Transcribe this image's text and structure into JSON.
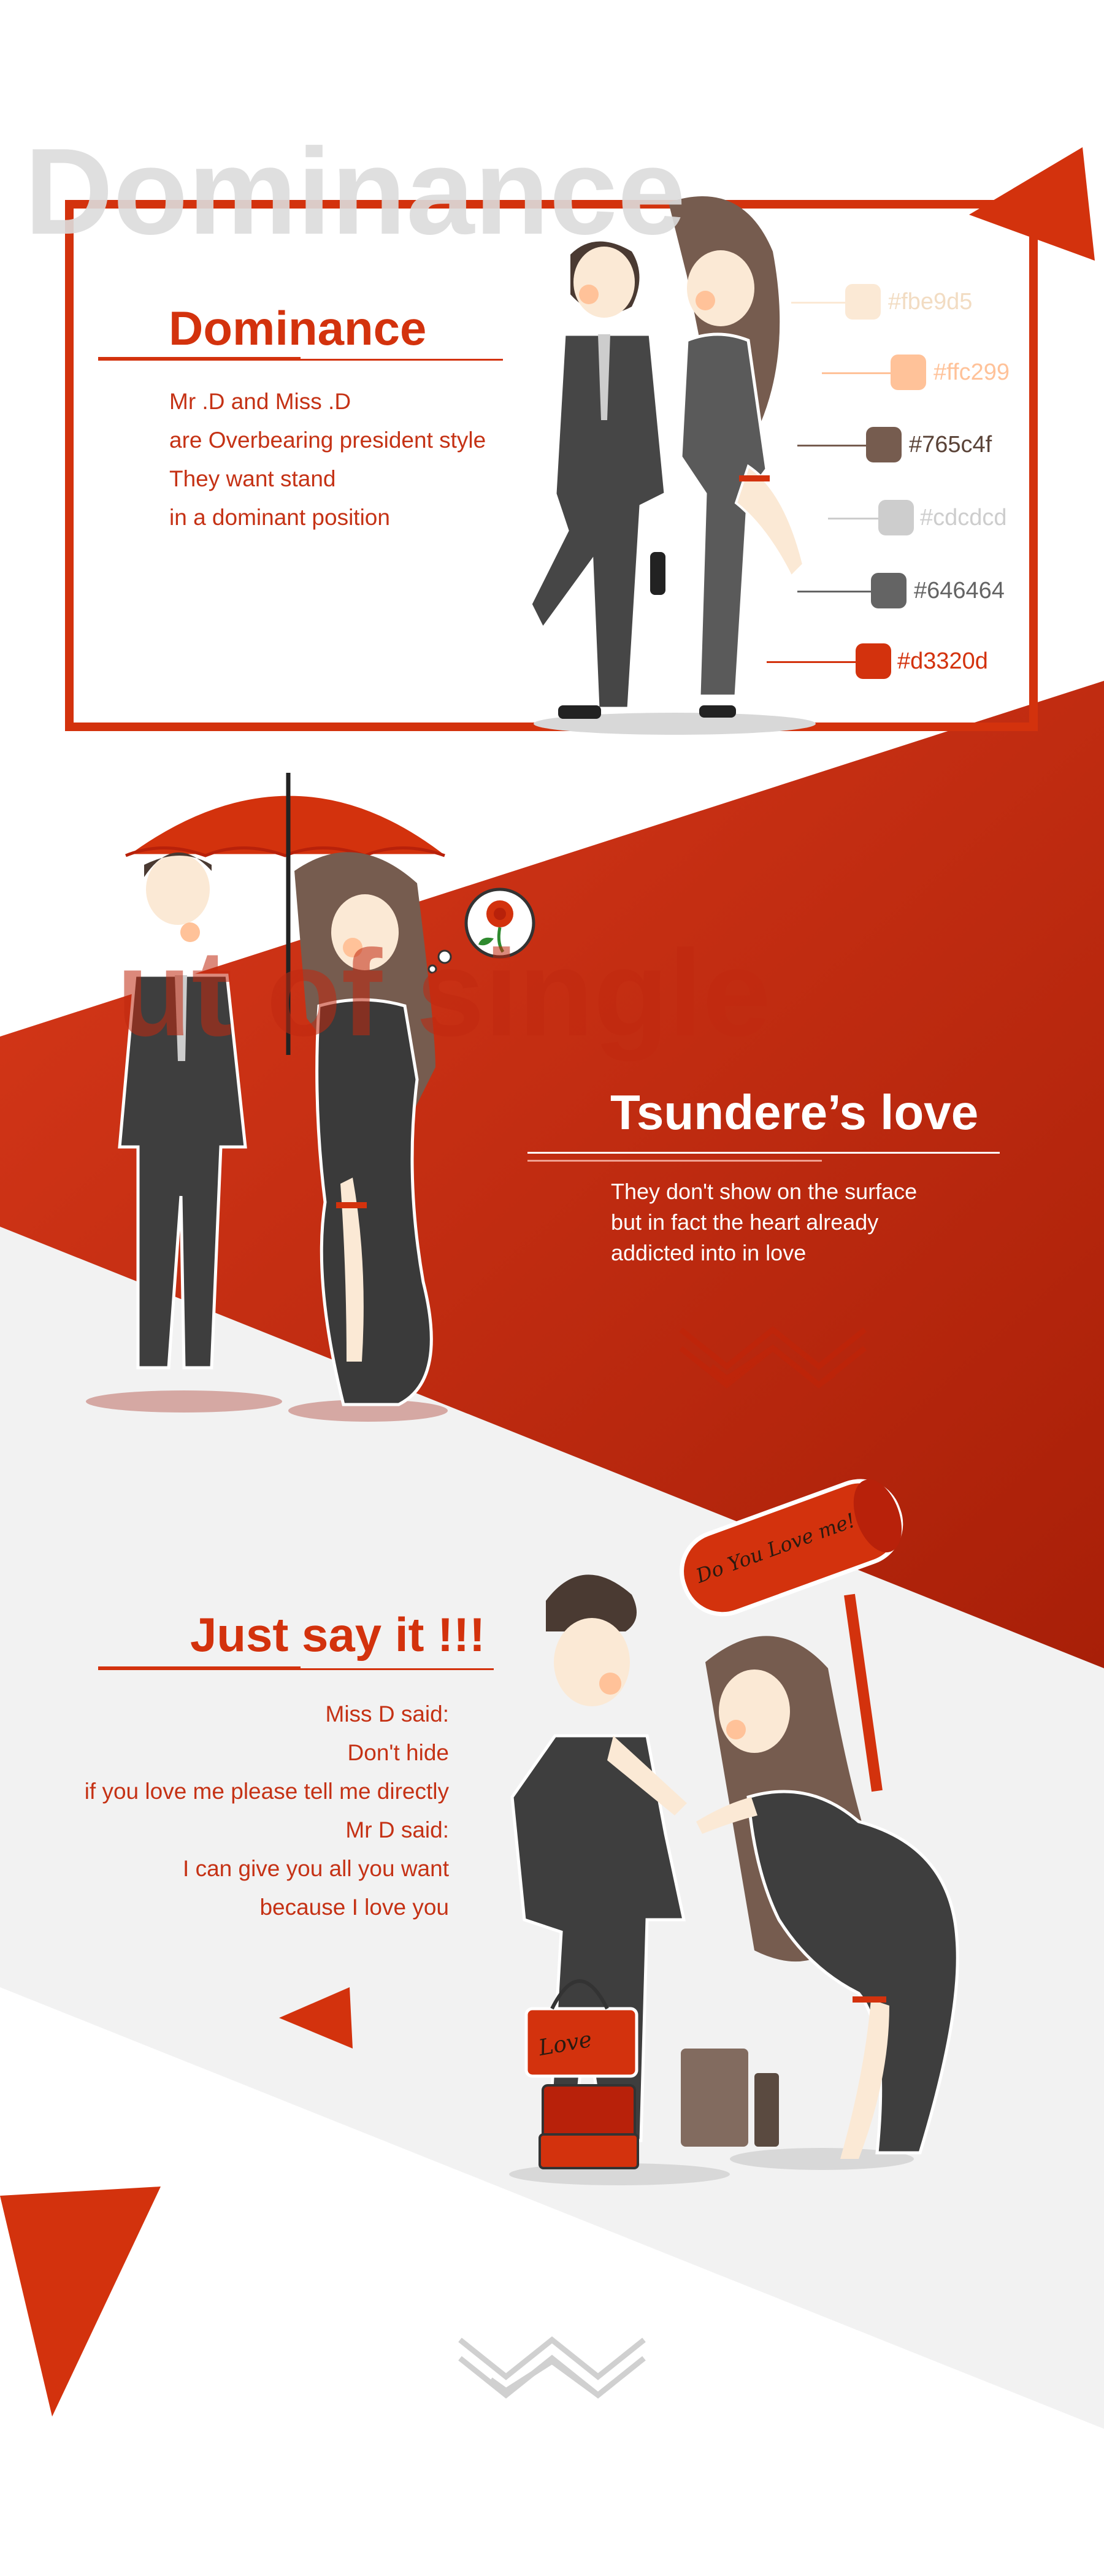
{
  "watermarks": {
    "top": "Dominance",
    "middle": "ut of single"
  },
  "sections": {
    "dominance": {
      "title": "Dominance",
      "lines": [
        "Mr .D and Miss .D",
        "are Overbearing president style",
        "They want stand",
        "in a dominant position"
      ]
    },
    "tsundere": {
      "title": "Tsundere’s love",
      "lines": [
        "They don't show on the surface",
        "but in fact the heart already",
        "addicted into in love"
      ]
    },
    "say_it": {
      "title": "Just say it !!!",
      "lines": [
        "Miss D said:",
        "Don't hide",
        "if you love me please tell me directly",
        "Mr D said:",
        "I can give you all you want",
        "because I love you"
      ]
    }
  },
  "palette": {
    "swatches": [
      {
        "hex": "#fbe9d5",
        "label": "#fbe9d5"
      },
      {
        "hex": "#ffc299",
        "label": "#ffc299"
      },
      {
        "hex": "#765c4f",
        "label": "#765c4f"
      },
      {
        "hex": "#cdcdcd",
        "label": "#cdcdcd"
      },
      {
        "hex": "#646464",
        "label": "#646464"
      },
      {
        "hex": "#d3320d",
        "label": "#d3320d"
      }
    ]
  },
  "illustration_text": {
    "mallet": "Do You Love me!",
    "bag": "Love"
  },
  "theme": {
    "accent": "#d3320d",
    "dark_red": "#b8210a",
    "light_gray": "#f2f2f2"
  },
  "icons": [
    "rose-icon",
    "zigzag-mark-icon",
    "triangle-decoration-icon"
  ]
}
